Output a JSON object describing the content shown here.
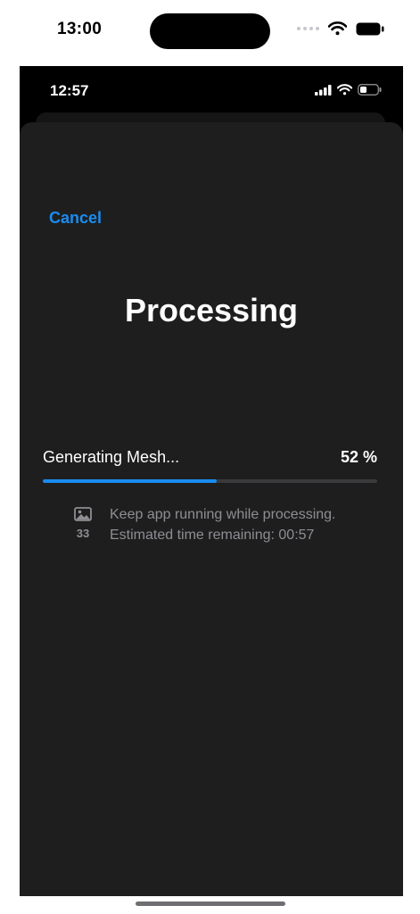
{
  "outer_status": {
    "time": "13:00"
  },
  "inner_status": {
    "time": "12:57"
  },
  "sheet": {
    "cancel_label": "Cancel",
    "title": "Processing",
    "stage_label": "Generating Mesh...",
    "percent_label": "52 %",
    "progress_fraction": 0.52,
    "image_count": "33",
    "info_line1": "Keep app running while processing.",
    "info_line2": "Estimated time remaining: 00:57"
  },
  "colors": {
    "accent": "#1a8cf0",
    "sheet_bg": "#1e1e1f",
    "secondary_text": "#8e8e93"
  }
}
